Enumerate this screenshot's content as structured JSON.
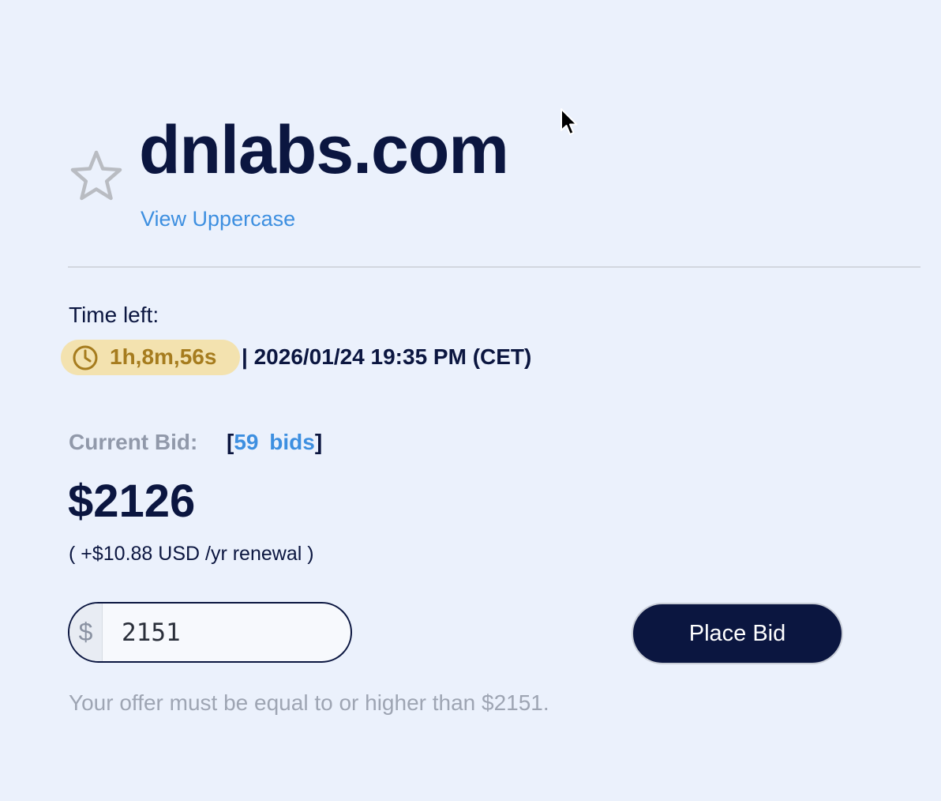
{
  "listing": {
    "domain": "dnlabs.com",
    "view_uppercase_label": "View Uppercase",
    "favorite_icon": "star-outline-icon"
  },
  "timer": {
    "label": "Time left:",
    "remaining": "1h,8m,56s",
    "end_time": "| 2026/01/24 19:35 PM (CET)",
    "icon": "clock-icon"
  },
  "bidding": {
    "current_bid_label": "Current Bid:",
    "bids_open_bracket": "[",
    "bids_count": "59  bids",
    "bids_close_bracket": "]",
    "current_bid_amount": "$2126",
    "renewal_note": "( +$10.88 USD /yr renewal )",
    "currency_symbol": "$",
    "bid_input_value": "2151",
    "place_bid_label": "Place Bid",
    "min_offer_note": "Your offer must be equal to or higher than $2151."
  },
  "colors": {
    "background": "#ebf1fc",
    "navy": "#0b1640",
    "link_blue": "#3d8fe0",
    "timer_pill_bg": "#f3e2af",
    "timer_text": "#a67c1e",
    "muted_gray": "#9199aa"
  }
}
